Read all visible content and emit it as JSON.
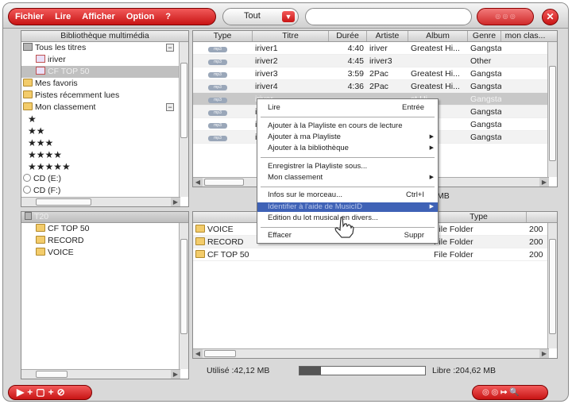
{
  "menu": [
    "Fichier",
    "Lire",
    "Afficher",
    "Option",
    "?"
  ],
  "filter": {
    "selected": "Tout"
  },
  "search": {
    "value": ""
  },
  "left_top": {
    "header": "Bibliothèque multimédia",
    "items": [
      {
        "label": "Tous les titres",
        "icon": "cabinet-icon"
      },
      {
        "label": "iriver",
        "icon": "playlist-icon"
      },
      {
        "label": "CF TOP 50",
        "icon": "playlist-icon"
      },
      {
        "label": "Mes favoris",
        "icon": "folder-icon"
      },
      {
        "label": "Pistes récemment lues",
        "icon": "folder-icon"
      },
      {
        "label": "Mon classement",
        "icon": "folder-icon"
      },
      {
        "label": "★"
      },
      {
        "label": "★★"
      },
      {
        "label": "★★★"
      },
      {
        "label": "★★★★"
      },
      {
        "label": "★★★★★"
      },
      {
        "label": "CD (E:)",
        "icon": "cd-icon"
      },
      {
        "label": "CD (F:)",
        "icon": "cd-icon"
      }
    ]
  },
  "tracks": {
    "columns": [
      "Type",
      "Titre",
      "Durée",
      "Artiste",
      "Album",
      "Genre",
      "mon clas..."
    ],
    "type_badge": "mp3",
    "rows": [
      {
        "title": "iriver1",
        "duration": "4:40",
        "artist": "iriver",
        "album": "Greatest Hi...",
        "genre": "Gangsta"
      },
      {
        "title": "iriver2",
        "duration": "4:45",
        "artist": "iriver3",
        "album": "",
        "genre": "Other"
      },
      {
        "title": "iriver3",
        "duration": "3:59",
        "artist": "2Pac",
        "album": "Greatest Hi...",
        "genre": "Gangsta"
      },
      {
        "title": "iriver4",
        "duration": "4:36",
        "artist": "2Pac",
        "album": "Greatest Hi...",
        "genre": "Gangsta"
      },
      {
        "title": "iriver",
        "duration": "",
        "artist": "",
        "album": "st Hi...",
        "genre": "Gangsta"
      },
      {
        "title": "iriver",
        "duration": "",
        "artist": "",
        "album": "st Hi...",
        "genre": "Gangsta"
      },
      {
        "title": "iriver",
        "duration": "",
        "artist": "",
        "album": "st Hi...",
        "genre": "Gangsta"
      },
      {
        "title": "iriver",
        "duration": "",
        "artist": "",
        "album": "st Hi...",
        "genre": "Gangsta"
      }
    ],
    "partial_size": "MB"
  },
  "context_menu": {
    "items": [
      {
        "label": "Lire",
        "shortcut": "Entrée"
      },
      {
        "label": "Ajouter à la Playliste en cours de lecture"
      },
      {
        "label": "Ajouter à ma Playliste",
        "submenu": true
      },
      {
        "label": "Ajouter à la bibliothèque",
        "submenu": true
      },
      {
        "label": "Enregistrer la Playliste sous..."
      },
      {
        "label": "Mon classement",
        "submenu": true
      },
      {
        "label": "Infos sur le morceau...",
        "shortcut": "Ctrl+I"
      },
      {
        "label": "Identifier à l'aide de MusicID",
        "submenu": true
      },
      {
        "label": "Edition du lot musical en divers..."
      },
      {
        "label": "Effacer",
        "shortcut": "Suppr"
      }
    ]
  },
  "left_bottom": {
    "header": "T20",
    "items": [
      "CF TOP 50",
      "RECORD",
      "VOICE"
    ]
  },
  "device_files": {
    "columns": [
      "",
      "Type"
    ],
    "rows": [
      {
        "name": "VOICE",
        "type": "File Folder",
        "extra": "200"
      },
      {
        "name": "RECORD",
        "type": "File Folder",
        "extra": "200"
      },
      {
        "name": "CF TOP 50",
        "type": "File Folder",
        "extra": "200"
      }
    ]
  },
  "storage": {
    "used": "Utilisé :42,12 MB",
    "free": "Libre :204,62 MB",
    "used_fraction": 0.17
  }
}
